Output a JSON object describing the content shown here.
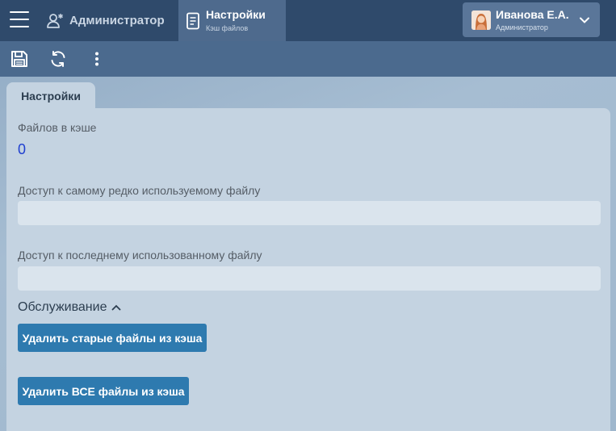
{
  "topbar": {
    "admin_label": "Администратор",
    "settings_tab": {
      "title": "Настройки",
      "subtitle": "Кэш файлов"
    },
    "user": {
      "name": "Иванова Е.А.",
      "role": "Администратор"
    }
  },
  "toolbar": {
    "icons": [
      "save-icon",
      "refresh-icon",
      "more-vertical-icon"
    ]
  },
  "panel": {
    "tab_label": "Настройки",
    "files_in_cache_label": "Файлов в кэше",
    "files_in_cache_value": "0",
    "least_used_label": "Доступ к самому редко используемому файлу",
    "least_used_value": "",
    "last_used_label": "Доступ к последнему использованному файлу",
    "last_used_value": "",
    "maintenance_label": "Обслуживание",
    "delete_old_button": "Удалить старые файлы из кэша",
    "delete_all_button": "Удалить ВСЕ файлы из кэша"
  },
  "colors": {
    "topbar": "#2f4a6b",
    "toolbar": "#4b6a8e",
    "active_tab": "#4e6a8d",
    "button": "#2e7aaf",
    "value_text": "#1f3fd0"
  }
}
